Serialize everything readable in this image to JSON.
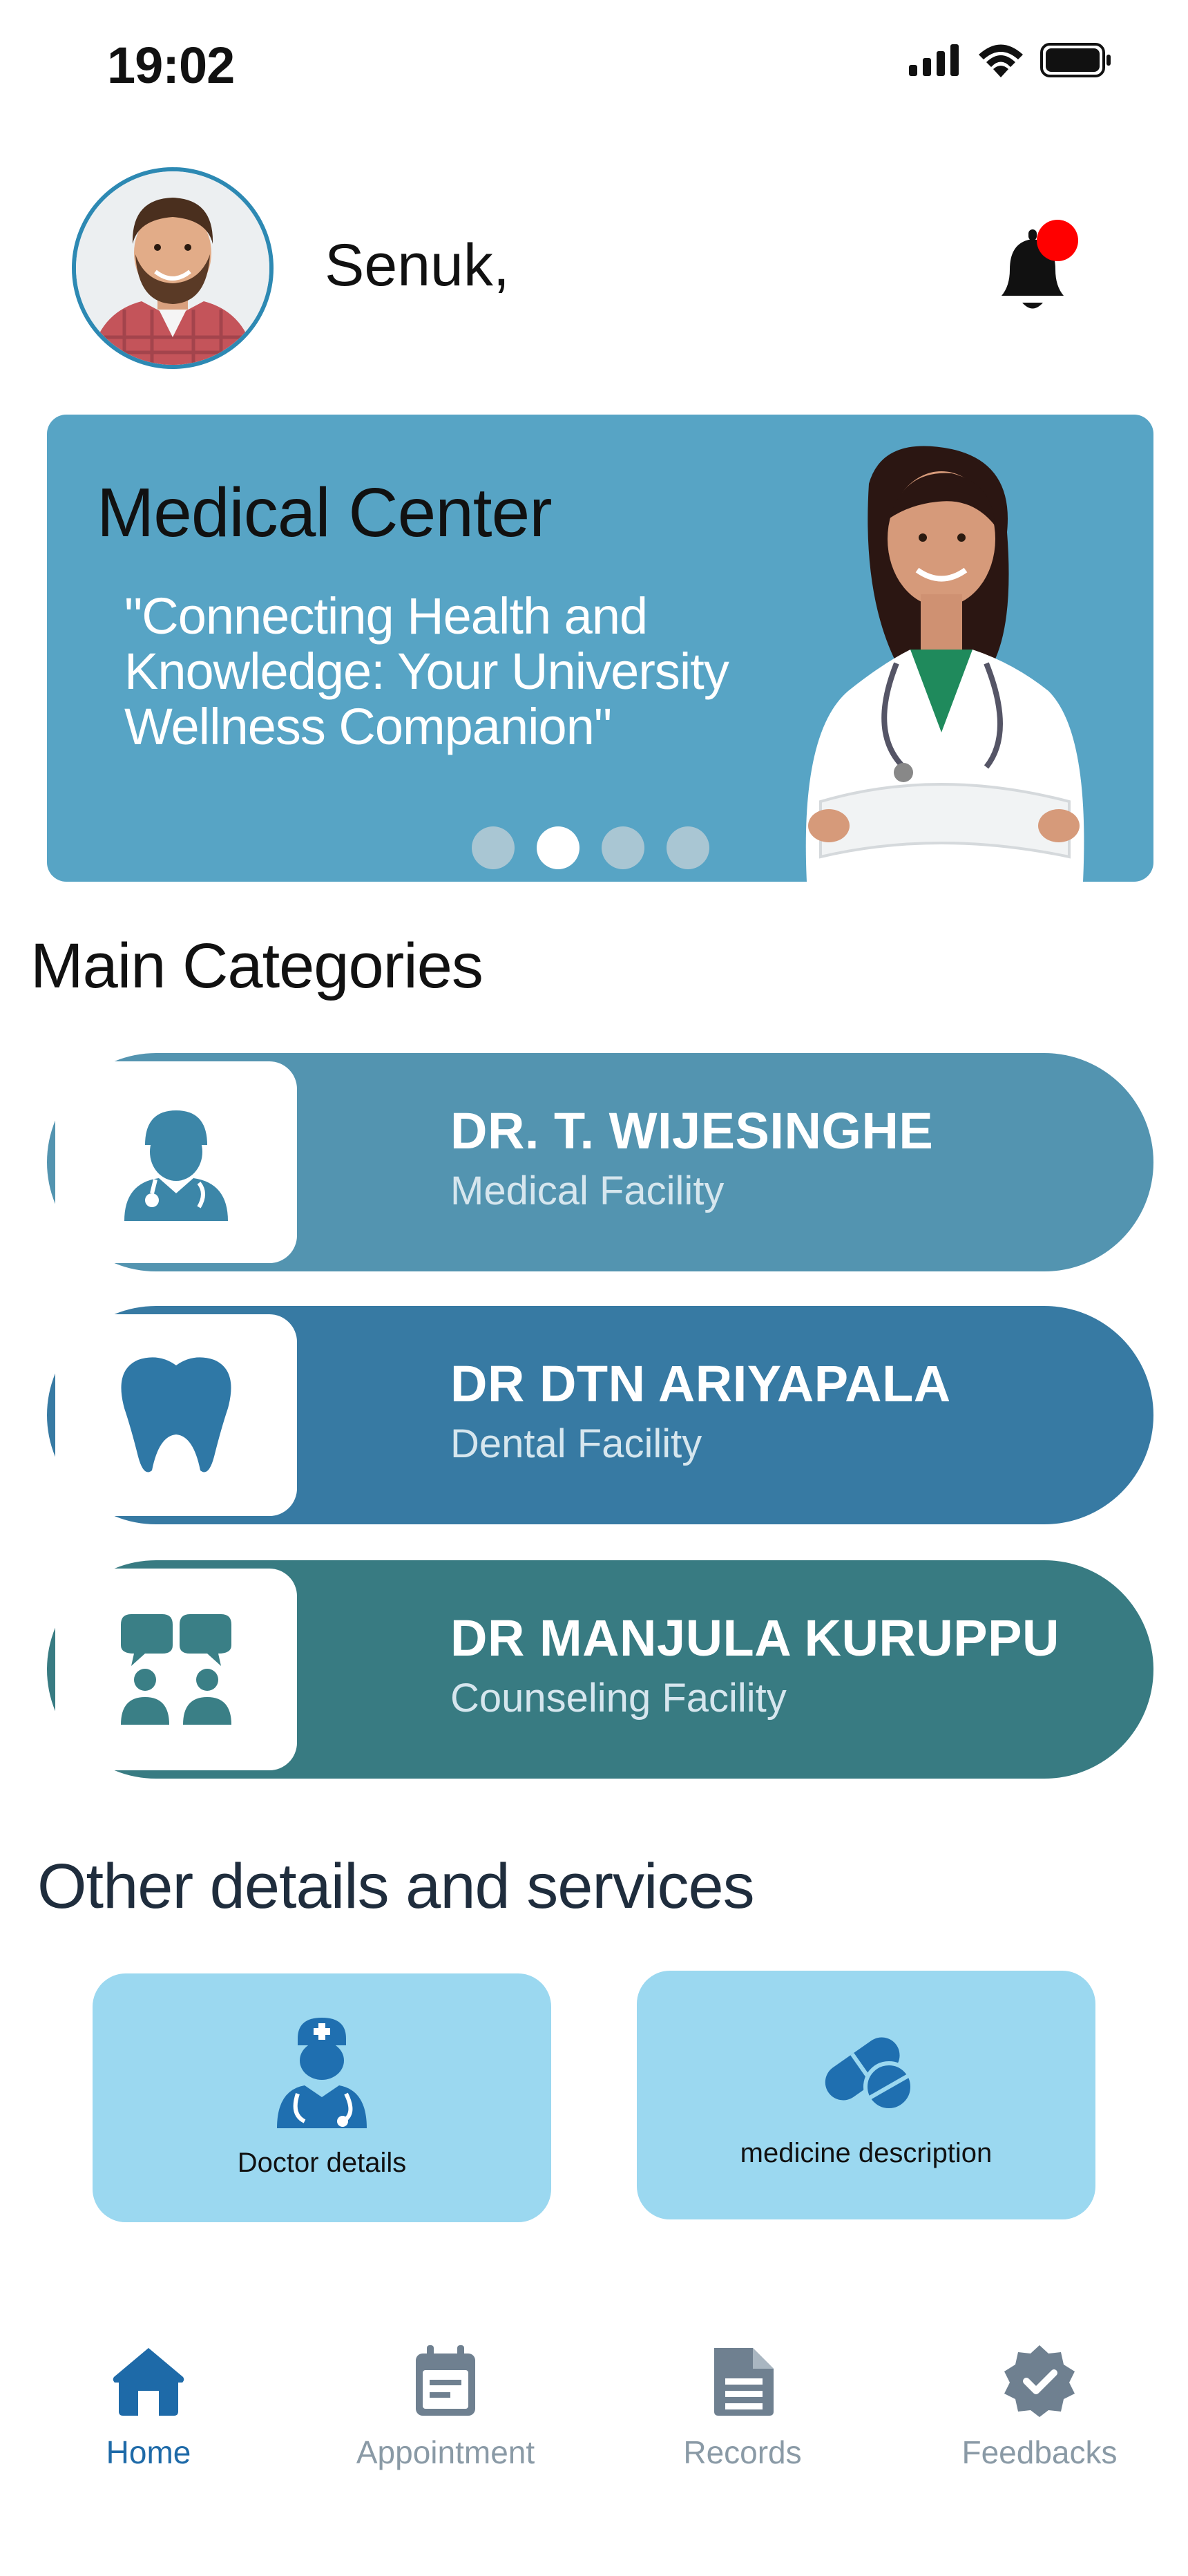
{
  "status_bar": {
    "time": "19:02"
  },
  "header": {
    "greeting": "Senuk,"
  },
  "banner": {
    "title": "Medical Center",
    "quote": "\"Connecting Health and Knowledge: Your University Wellness Companion\"",
    "slides": 4,
    "active_slide": 2
  },
  "main_categories": {
    "title": "Main Categories",
    "items": [
      {
        "name": "DR. T. WIJESINGHE",
        "facility": "Medical Facility",
        "icon": "doctor-icon",
        "color": "#5394b0"
      },
      {
        "name": "DR DTN ARIYAPALA",
        "facility": "Dental Facility",
        "icon": "tooth-icon",
        "color": "#377aa3"
      },
      {
        "name": "DR MANJULA KURUPPU",
        "facility": "Counseling Facility",
        "icon": "counseling-icon",
        "color": "#387b82"
      }
    ]
  },
  "other_services": {
    "title": "Other details and  services",
    "items": [
      {
        "label": "Doctor details",
        "icon": "nurse-doctor-icon"
      },
      {
        "label": "medicine description",
        "icon": "pills-icon"
      }
    ]
  },
  "bottom_nav": {
    "items": [
      {
        "label": "Home",
        "icon": "home-icon",
        "active": true
      },
      {
        "label": "Appointment",
        "icon": "calendar-icon",
        "active": false
      },
      {
        "label": "Records",
        "icon": "document-icon",
        "active": false
      },
      {
        "label": "Feedbacks",
        "icon": "verified-badge-icon",
        "active": false
      }
    ]
  },
  "colors": {
    "primary": "#1e6aa8",
    "banner": "#57a4c5",
    "service_tile": "#9bd8f0",
    "notification_dot": "#ff0000"
  }
}
